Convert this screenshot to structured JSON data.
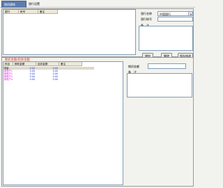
{
  "tabs": [
    {
      "label": "期初建帐"
    },
    {
      "label": "银行设置"
    }
  ],
  "bank_panel": {
    "title": "银行帐户",
    "columns": [
      "银行",
      "帐号",
      "备注"
    ],
    "form": {
      "bank_name_label": "银行名称",
      "bank_name_value": "中国银行",
      "account_label": "银行帐号",
      "account_value": "",
      "remark_label": "备　注",
      "remark_value": ""
    },
    "buttons": {
      "add": "增加",
      "delete": "删除",
      "save": "保存修改"
    }
  },
  "balance_panel": {
    "title": "期初金额/结余金额",
    "columns": [
      "科目",
      "期初金额",
      "结存金额",
      "备注"
    ],
    "rows": [
      {
        "subject": "现金",
        "opening": "0.00",
        "balance": "0.00",
        "remark": "",
        "color": "#000000"
      },
      {
        "subject": "新账户1",
        "opening": "0.00",
        "balance": "0.00",
        "remark": "",
        "color": "#e020e0"
      },
      {
        "subject": "新账户2",
        "opening": "0.00",
        "balance": "0.00",
        "remark": "",
        "color": "#e020e0"
      },
      {
        "subject": "新账户3",
        "opening": "0.00",
        "balance": "0.00",
        "remark": "",
        "color": "#e020e0"
      },
      {
        "subject": "新账户4",
        "opening": "0.00",
        "balance": "0.00",
        "remark": "",
        "color": "#e020e0"
      }
    ],
    "form": {
      "opening_label": "期初金额",
      "opening_value": "",
      "remark_label": "备　注",
      "remark_value": ""
    }
  }
}
